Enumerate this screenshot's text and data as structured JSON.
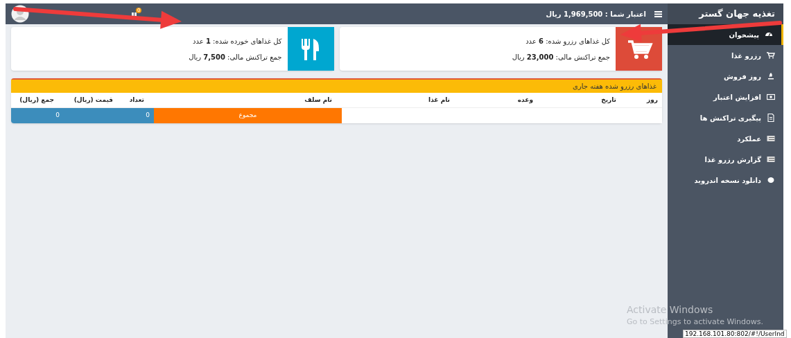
{
  "topbar": {
    "brand": "تغذیه جهان گستر",
    "credit": "اعتبار شما : 1,969,500 ریال",
    "notification_count": "0"
  },
  "sidebar": {
    "items": [
      {
        "label": "پیشخوان",
        "selected": true
      },
      {
        "label": "رزرو غذا",
        "selected": false
      },
      {
        "label": "روز فروش",
        "selected": false
      },
      {
        "label": "افزایش اعتبار",
        "selected": false
      },
      {
        "label": "پیگیری تراکنش ها",
        "selected": false
      },
      {
        "label": "عملکرد",
        "selected": false
      },
      {
        "label": "گزارش رزرو غذا",
        "selected": false
      },
      {
        "label": "دانلود نسخه اندروید",
        "selected": false
      }
    ]
  },
  "cards": [
    {
      "kind": "cart",
      "color": "#dd4b39",
      "line_1": "کل غذاهای رزرو شده: **6** عدد",
      "line_2": "جمع تراکنش مالی: **23,000** ریال"
    },
    {
      "kind": "food",
      "color": "#00a7d0",
      "line_1": "کل غذاهای خورده شده: **1** عدد",
      "line_2": "جمع تراکنش مالی: **7,500** ریال"
    }
  ],
  "table": {
    "title": "غذاهای رزرو شده هفته جاری",
    "columns": [
      "روز",
      "تاریخ",
      "وعده",
      "نام غذا",
      "نام سلف",
      "تعداد",
      "قیمت (ریال)",
      "جمع (ریال)"
    ],
    "total_row": {
      "label": "مجموع",
      "count": "0",
      "sum": "0"
    }
  },
  "annotations": [
    {
      "kind": "arrow"
    },
    {
      "kind": "arrow"
    }
  ],
  "os_overlay": {
    "title": "Activate Windows",
    "subtitle": "Go to Settings to activate Windows.",
    "status_url": "192.168.101.80:802/#!/UserInd"
  }
}
